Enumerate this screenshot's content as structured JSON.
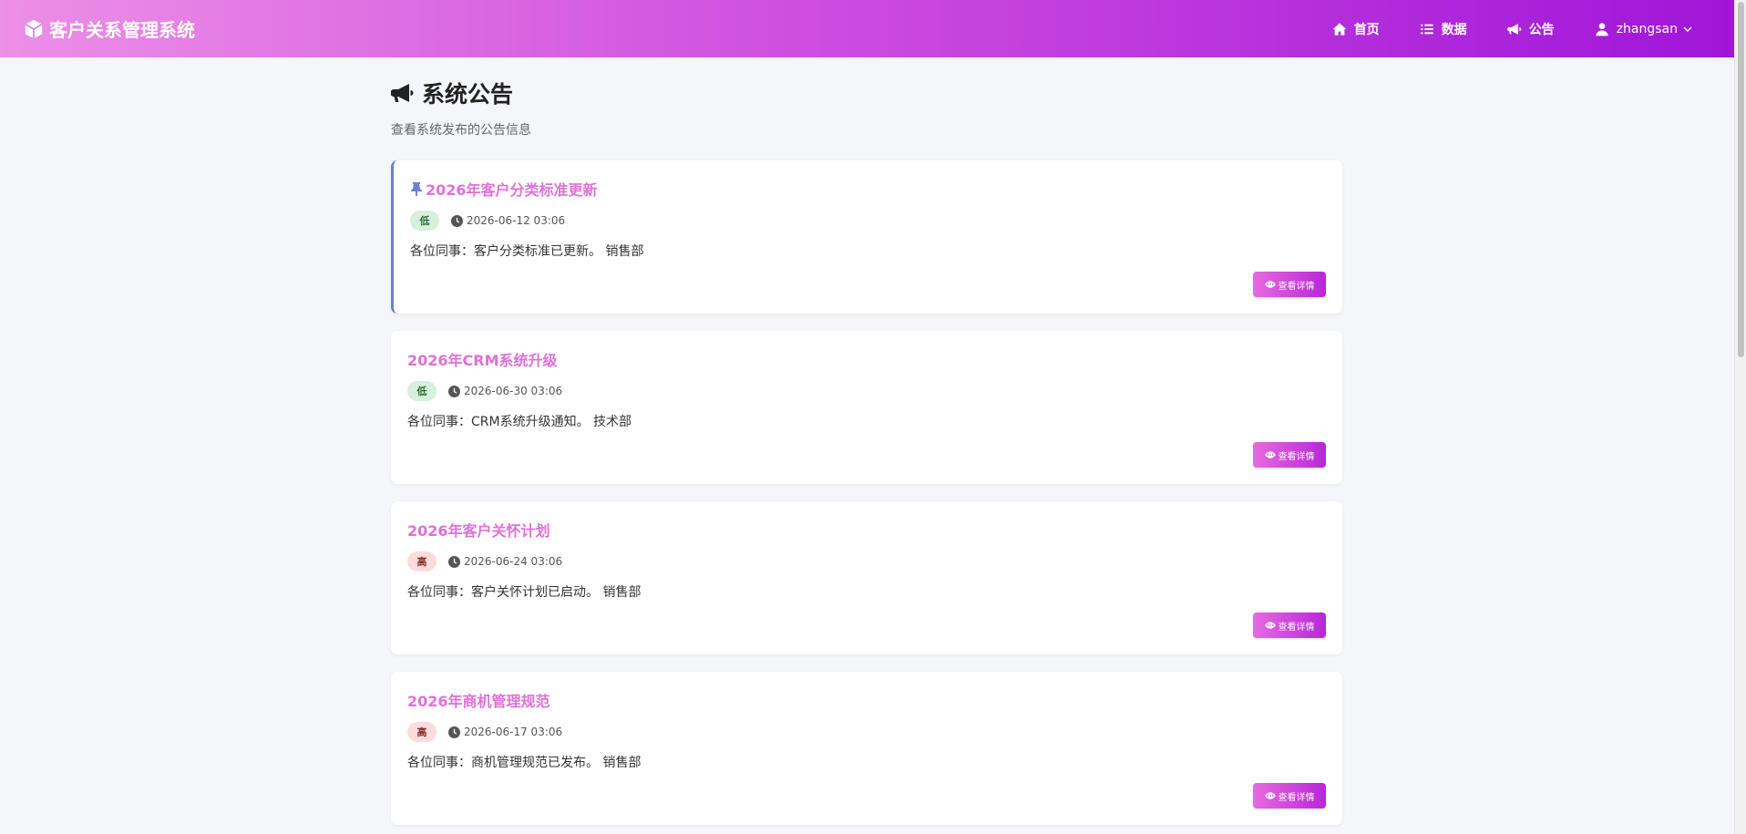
{
  "navbar": {
    "brand": "客户关系管理系统",
    "items": [
      {
        "label": "首页",
        "icon": "home-icon"
      },
      {
        "label": "数据",
        "icon": "list-icon"
      },
      {
        "label": "公告",
        "icon": "megaphone-icon"
      }
    ],
    "user": {
      "name": "zhangsan",
      "icon": "user-icon"
    }
  },
  "page": {
    "title": "系统公告",
    "subtitle": "查看系统发布的公告信息"
  },
  "announcements": [
    {
      "title": "2026年客户分类标准更新",
      "priority": "低",
      "priority_level": "low",
      "time": "2026-06-12 03:06",
      "content": "各位同事：客户分类标准已更新。 销售部",
      "pinned": true,
      "action": "查看详情"
    },
    {
      "title": "2026年CRM系统升级",
      "priority": "低",
      "priority_level": "low",
      "time": "2026-06-30 03:06",
      "content": "各位同事：CRM系统升级通知。 技术部",
      "pinned": false,
      "action": "查看详情"
    },
    {
      "title": "2026年客户关怀计划",
      "priority": "高",
      "priority_level": "high",
      "time": "2026-06-24 03:06",
      "content": "各位同事：客户关怀计划已启动。 销售部",
      "pinned": false,
      "action": "查看详情"
    },
    {
      "title": "2026年商机管理规范",
      "priority": "高",
      "priority_level": "high",
      "time": "2026-06-17 03:06",
      "content": "各位同事：商机管理规范已发布。 销售部",
      "pinned": false,
      "action": "查看详情"
    }
  ],
  "colors": {
    "accent": "#e070d8",
    "pin": "#6b7fd7",
    "nav_gradient_start": "#ec8fe6",
    "nav_gradient_end": "#9f16d8"
  }
}
